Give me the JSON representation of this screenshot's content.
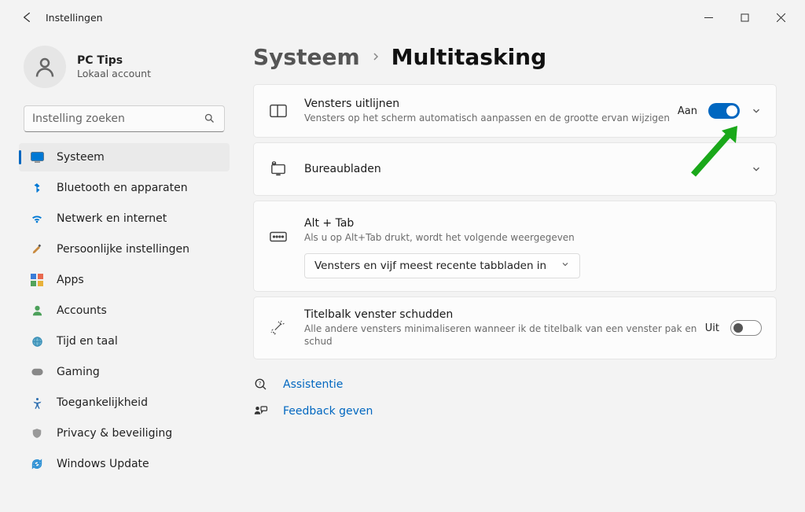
{
  "window": {
    "title": "Instellingen"
  },
  "account": {
    "name": "PC Tips",
    "subtitle": "Lokaal account"
  },
  "search": {
    "placeholder": "Instelling zoeken"
  },
  "nav": {
    "items": [
      {
        "label": "Systeem"
      },
      {
        "label": "Bluetooth en apparaten"
      },
      {
        "label": "Netwerk en internet"
      },
      {
        "label": "Persoonlijke instellingen"
      },
      {
        "label": "Apps"
      },
      {
        "label": "Accounts"
      },
      {
        "label": "Tijd en taal"
      },
      {
        "label": "Gaming"
      },
      {
        "label": "Toegankelijkheid"
      },
      {
        "label": "Privacy & beveiliging"
      },
      {
        "label": "Windows Update"
      }
    ]
  },
  "breadcrumb": {
    "parent": "Systeem",
    "current": "Multitasking"
  },
  "cards": {
    "snap": {
      "title": "Vensters uitlijnen",
      "sub": "Vensters op het scherm automatisch aanpassen en de grootte ervan wijzigen",
      "state": "Aan"
    },
    "desktops": {
      "title": "Bureaubladen"
    },
    "alttab": {
      "title": "Alt + Tab",
      "sub": "Als u op Alt+Tab drukt, wordt het volgende weergegeven",
      "dropdown": "Vensters en vijf meest recente tabbladen in"
    },
    "shake": {
      "title": "Titelbalk venster schudden",
      "sub": "Alle andere vensters minimaliseren wanneer ik de titelbalk van een venster pak en schud",
      "state": "Uit"
    }
  },
  "links": {
    "help": "Assistentie",
    "feedback": "Feedback geven"
  }
}
